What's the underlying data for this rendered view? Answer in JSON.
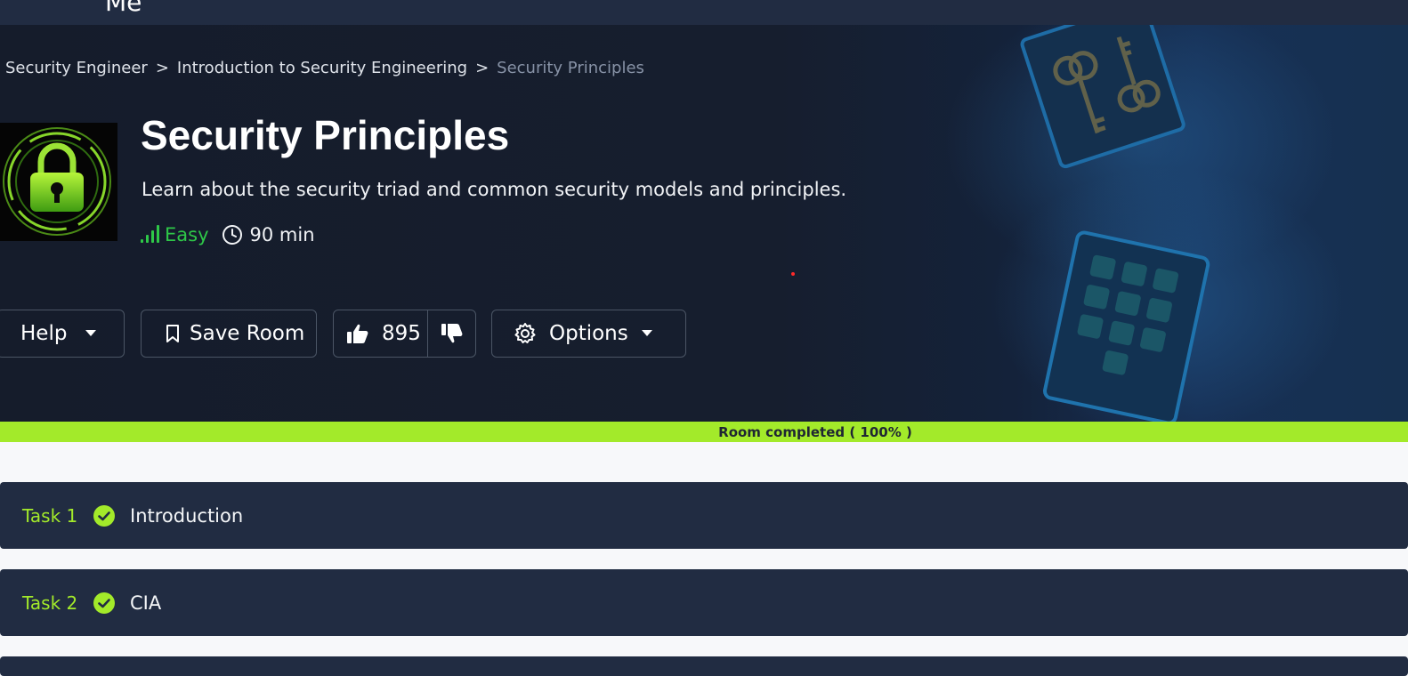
{
  "nav": {
    "partial_label": "Me"
  },
  "breadcrumb": {
    "items": [
      "Security Engineer",
      "Introduction to Security Engineering"
    ],
    "current": "Security Principles",
    "separator": ">"
  },
  "room": {
    "title": "Security Principles",
    "description": "Learn about the security triad and common security models and principles.",
    "difficulty": "Easy",
    "duration": "90 min"
  },
  "actions": {
    "help_label": "Help",
    "save_label": "Save Room",
    "like_count": "895",
    "options_label": "Options"
  },
  "progress": {
    "label": "Room completed ( 100% )",
    "value_percent": 100
  },
  "tasks": [
    {
      "number": "Task 1",
      "title": "Introduction",
      "completed": true
    },
    {
      "number": "Task 2",
      "title": "CIA",
      "completed": true
    }
  ],
  "colors": {
    "accent": "#a3ea2a",
    "difficulty_easy": "#2ec748",
    "hero_bg": "#151c2b",
    "task_bg": "#212c42"
  },
  "icons": [
    "lock-icon",
    "signal-bars-icon",
    "clock-icon",
    "caret-down-icon",
    "bookmark-icon",
    "thumbs-up-icon",
    "thumbs-down-icon",
    "gear-icon",
    "check-circle-icon"
  ]
}
